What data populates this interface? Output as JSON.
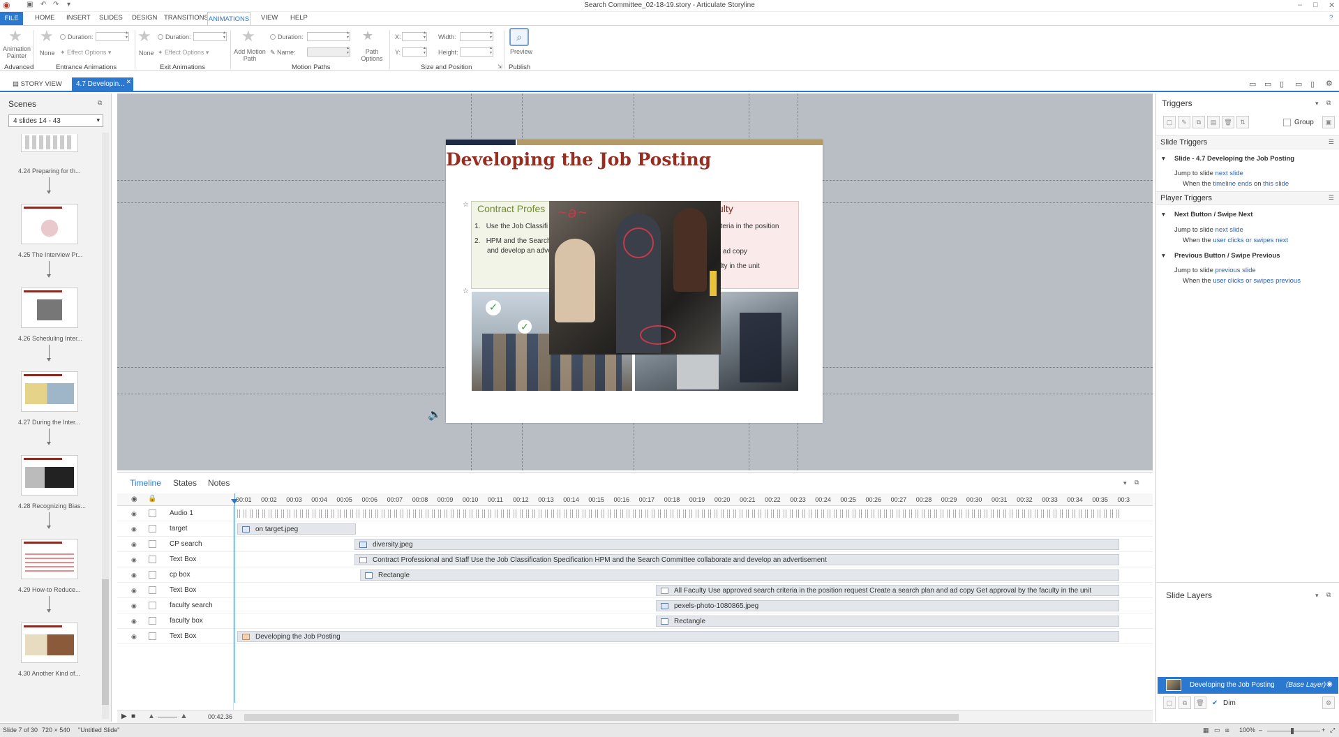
{
  "window": {
    "title": "Search Committee_02-18-19.story - Articulate Storyline"
  },
  "menu": {
    "file": "FILE",
    "tabs": [
      "HOME",
      "INSERT",
      "SLIDES",
      "DESIGN",
      "TRANSITIONS",
      "ANIMATIONS",
      "VIEW",
      "HELP"
    ]
  },
  "ribbon": {
    "animation_painter": "Animation Painter",
    "advanced": "Advanced",
    "entrance": {
      "none": "None",
      "duration": "Duration:",
      "effect_options": "Effect Options",
      "group": "Entrance Animations"
    },
    "exit": {
      "none": "None",
      "duration": "Duration:",
      "effect_options": "Effect Options",
      "group": "Exit Animations"
    },
    "motion": {
      "add": "Add Motion Path",
      "duration": "Duration:",
      "name": "Name:",
      "path_options": "Path Options",
      "group": "Motion Paths"
    },
    "size": {
      "x": "X:",
      "y": "Y:",
      "width": "Width:",
      "height": "Height:",
      "group": "Size and Position"
    },
    "publish": {
      "preview": "Preview",
      "group": "Publish"
    }
  },
  "tabs": {
    "story_view": "STORY VIEW",
    "slide": "4.7 Developin..."
  },
  "scenes": {
    "title": "Scenes",
    "select": "4 slides 14 - 43",
    "items": [
      {
        "label": "4.24 Preparing for th..."
      },
      {
        "label": "4.25 The Interview Pr..."
      },
      {
        "label": "4.26 Scheduling Inter..."
      },
      {
        "label": "4.27 During the Inter..."
      },
      {
        "label": "4.28 Recognizing Bias..."
      },
      {
        "label": "4.29 How-to Reduce..."
      },
      {
        "label": "4.30 Another Kind of..."
      }
    ]
  },
  "slide": {
    "title": "Developing the Job Posting",
    "cp_heading": "Contract Profes",
    "faculty_heading": "culty",
    "cp_items": [
      "Use the Job Classifi",
      "HPM and the Search",
      "and develop an adve"
    ],
    "faculty_items": [
      "criteria in the position",
      "nd ad copy",
      "culty in the unit"
    ]
  },
  "timeline": {
    "tabs": [
      "Timeline",
      "States",
      "Notes"
    ],
    "ticks": [
      "00:01",
      "00:02",
      "00:03",
      "00:04",
      "00:05",
      "00:06",
      "00:07",
      "00:08",
      "00:09",
      "00:10",
      "00:11",
      "00:12",
      "00:13",
      "00:14",
      "00:15",
      "00:16",
      "00:17",
      "00:18",
      "00:19",
      "00:20",
      "00:21",
      "00:22",
      "00:23",
      "00:24",
      "00:25",
      "00:26",
      "00:27",
      "00:28",
      "00:29",
      "00:30",
      "00:31",
      "00:32",
      "00:33",
      "00:34",
      "00:35",
      "00:3"
    ],
    "rows": [
      {
        "name": "Audio 1",
        "bar": ""
      },
      {
        "name": "target",
        "bar": "on target.jpeg"
      },
      {
        "name": "CP search",
        "bar": "diversity.jpeg"
      },
      {
        "name": "Text Box",
        "bar": "Contract Professional and Staff Use the Job Classification Specification HPM and the Search Committee collaborate and develop an advertisement"
      },
      {
        "name": "cp box",
        "bar": "Rectangle"
      },
      {
        "name": "Text Box",
        "bar": "All Faculty Use approved search criteria in the position request Create a search plan and ad copy Get approval by the faculty in the unit"
      },
      {
        "name": "faculty search",
        "bar": "pexels-photo-1080865.jpeg"
      },
      {
        "name": "faculty box",
        "bar": "Rectangle"
      },
      {
        "name": "Text Box",
        "bar": "Developing the Job Posting"
      }
    ],
    "duration": "00:42.36"
  },
  "triggers": {
    "title": "Triggers",
    "group": "Group",
    "slide_triggers": "Slide Triggers",
    "slide_name": "Slide - 4.7 Developing the Job Posting",
    "t1_jump": "Jump to slide",
    "t1_target": "next slide",
    "t1_when": "When the",
    "t1_event": "timeline ends",
    "t1_on": "on",
    "t1_obj": "this slide",
    "player_triggers": "Player Triggers",
    "next_btn": "Next Button / Swipe Next",
    "t2_jump": "Jump to slide",
    "t2_target": "next slide",
    "t2_when": "When the",
    "t2_event": "user clicks or swipes",
    "t2_obj": "next",
    "prev_btn": "Previous Button / Swipe Previous",
    "t3_jump": "Jump to slide",
    "t3_target": "previous slide",
    "t3_when": "When the",
    "t3_event": "user clicks or swipes",
    "t3_obj": "previous"
  },
  "layers": {
    "title": "Slide Layers",
    "base_name": "Developing the Job Posting",
    "base_tag": "(Base Layer)",
    "dim": "Dim"
  },
  "status": {
    "slide": "Slide 7 of 30",
    "size": "720 × 540",
    "master": "\"Untitled Slide\"",
    "zoom": "100%"
  },
  "colors": {
    "accent": "#2a78d0",
    "title": "#962e22",
    "gold": "#b49b66",
    "navy": "#1f2a44"
  }
}
